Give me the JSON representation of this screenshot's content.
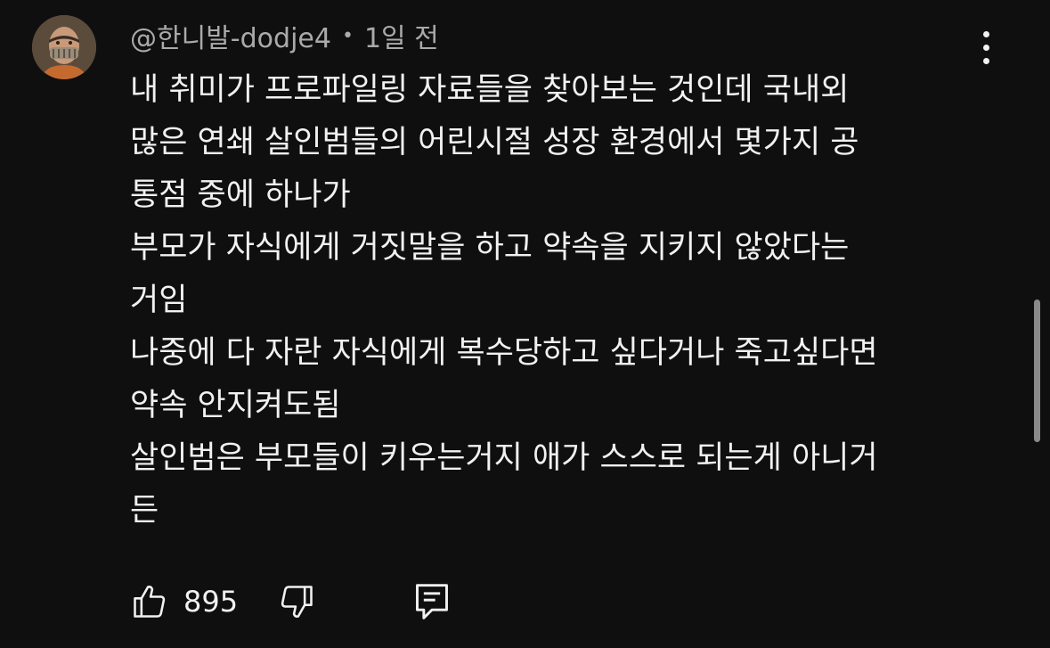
{
  "comment": {
    "author": "@한니발-dodje4",
    "separator": "•",
    "timestamp": "1일 전",
    "avatar_icon": "hannibal-mask-avatar",
    "menu_icon": "more-vertical-icon",
    "lines": [
      "내 취미가 프로파일링 자료들을 찾아보는 것인데 국내외",
      "많은 연쇄 살인범들의 어린시절 성장 환경에서 몇가지 공",
      "통점 중에 하나가",
      "부모가 자식에게 거짓말을 하고 약속을 지키지 않았다는",
      "거임",
      "나중에 다 자란 자식에게 복수당하고 싶다거나 죽고싶다면",
      "약속 안지켜도됨",
      "살인범은 부모들이 키우는거지 애가 스스로 되는게 아니거",
      "든"
    ],
    "actions": {
      "like_icon": "thumbs-up-icon",
      "like_count": "895",
      "dislike_icon": "thumbs-down-icon",
      "reply_icon": "reply-comment-icon"
    }
  },
  "colors": {
    "background": "#0f0f0f",
    "text": "#f1f1f1",
    "secondary_text": "#aaaaaa",
    "scrollbar": "#8a8a8a"
  }
}
